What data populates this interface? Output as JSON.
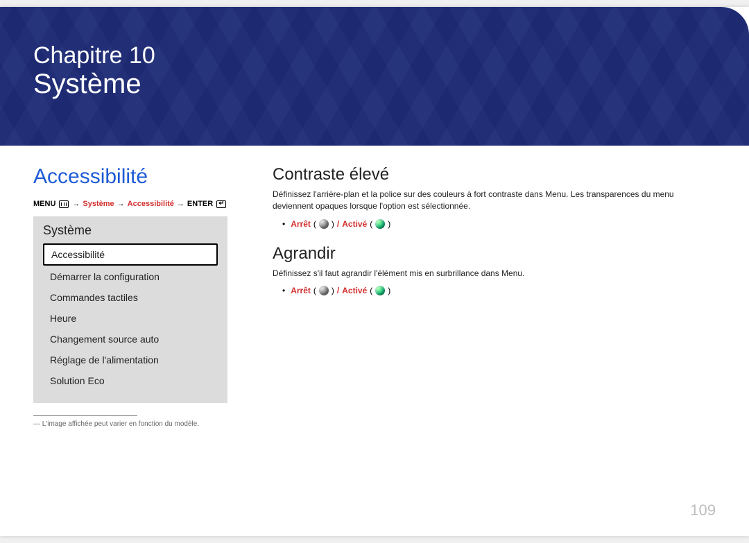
{
  "banner": {
    "chapter": "Chapitre 10",
    "title": "Système"
  },
  "left": {
    "heading": "Accessibilité",
    "breadcrumb": {
      "menu": "MENU",
      "systeme": "Système",
      "accessibilite": "Accessibilité",
      "enter": "ENTER"
    },
    "panel": {
      "title": "Système",
      "items": [
        "Accessibilité",
        "Démarrer la configuration",
        "Commandes tactiles",
        "Heure",
        "Changement source auto",
        "Réglage de l'alimentation",
        "Solution Eco"
      ]
    },
    "footnote": "― L'image affichée peut varier en fonction du modèle."
  },
  "right": {
    "section1": {
      "heading": "Contraste élevé",
      "desc": "Définissez l'arrière-plan et la police sur des couleurs à fort contraste dans Menu. Les transparences du menu deviennent opaques lorsque l'option est sélectionnée.",
      "opt_off": "Arrêt",
      "opt_sep": " / ",
      "opt_on": "Activé"
    },
    "section2": {
      "heading": "Agrandir",
      "desc": "Définissez s'il faut agrandir l'élément mis en surbrillance dans Menu.",
      "opt_off": "Arrêt",
      "opt_sep": " / ",
      "opt_on": "Activé"
    }
  },
  "page_number": "109"
}
